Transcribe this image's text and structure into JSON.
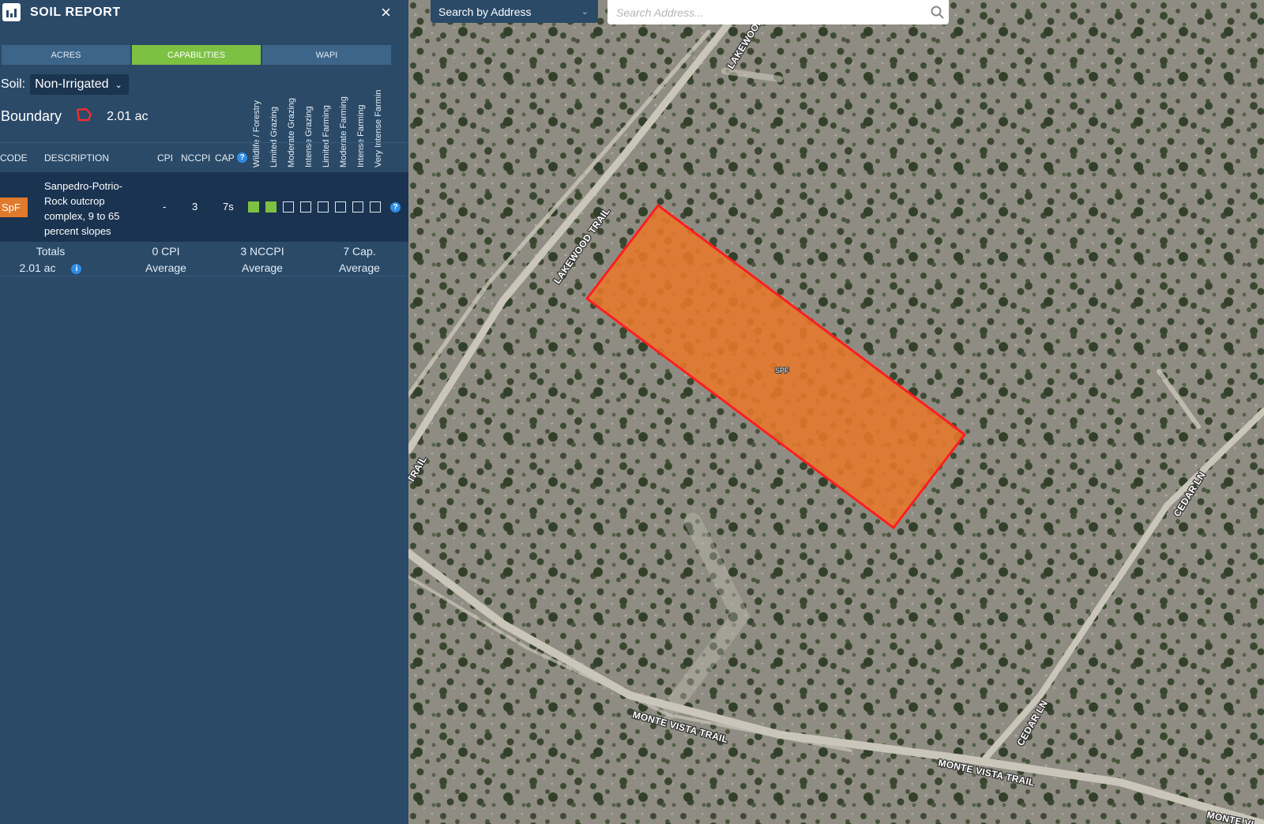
{
  "panel": {
    "title": "SOIL REPORT",
    "close_label": "×",
    "tabs": [
      {
        "label": "ACRES",
        "active": false
      },
      {
        "label": "CAPABILITIES",
        "active": true
      },
      {
        "label": "WAPI",
        "active": false
      }
    ],
    "soil": {
      "label": "Soil:",
      "value": "Non-Irrigated"
    },
    "boundary": {
      "label": "Boundary",
      "acres": "2.01 ac"
    },
    "capability_headers": [
      "Wildlife / Forestry",
      "Limited Grazing",
      "Moderate Grazing",
      "Intense Grazing",
      "Limited Farming",
      "Moderate Farming",
      "Intense Farming",
      "Very Intense Farmin"
    ],
    "columns": {
      "code": "CODE",
      "description": "DESCRIPTION",
      "cpi": "CPI",
      "nccpi": "NCCPI",
      "cap": "CAP"
    },
    "rows": [
      {
        "code": "SpF",
        "description": "Sanpedro-Potrio-Rock outcrop complex, 9 to 65 percent slopes",
        "cpi": "-",
        "nccpi": "3",
        "cap": "7s",
        "capabilities": [
          true,
          true,
          false,
          false,
          false,
          false,
          false,
          false
        ]
      }
    ],
    "totals": {
      "label": "Totals",
      "acres": "2.01 ac",
      "cpi": "0 CPI",
      "cpi_sub": "Average",
      "nccpi": "3 NCCPI",
      "nccpi_sub": "Average",
      "cap": "7 Cap.",
      "cap_sub": "Average"
    },
    "colors": {
      "panel": "#2a4a68",
      "active_tab": "#7dc142",
      "tab": "#3d6589",
      "code_badge": "#e07a2c",
      "row": "#1a3351"
    }
  },
  "search": {
    "mode": "Search by Address",
    "placeholder": "Search Address..."
  },
  "map": {
    "parcel_label": "SPF",
    "parcel_fill": "#e8782a",
    "parcel_stroke": "#ff1e1e",
    "road_labels": [
      "LAKEWOOD",
      "LAKEWOOD TRAIL",
      "TRAIL",
      "CEDAR LN",
      "CEDAR LN",
      "MONTE VISTA TRAIL",
      "MONTE VISTA TRAIL",
      "MONTE VI"
    ]
  }
}
